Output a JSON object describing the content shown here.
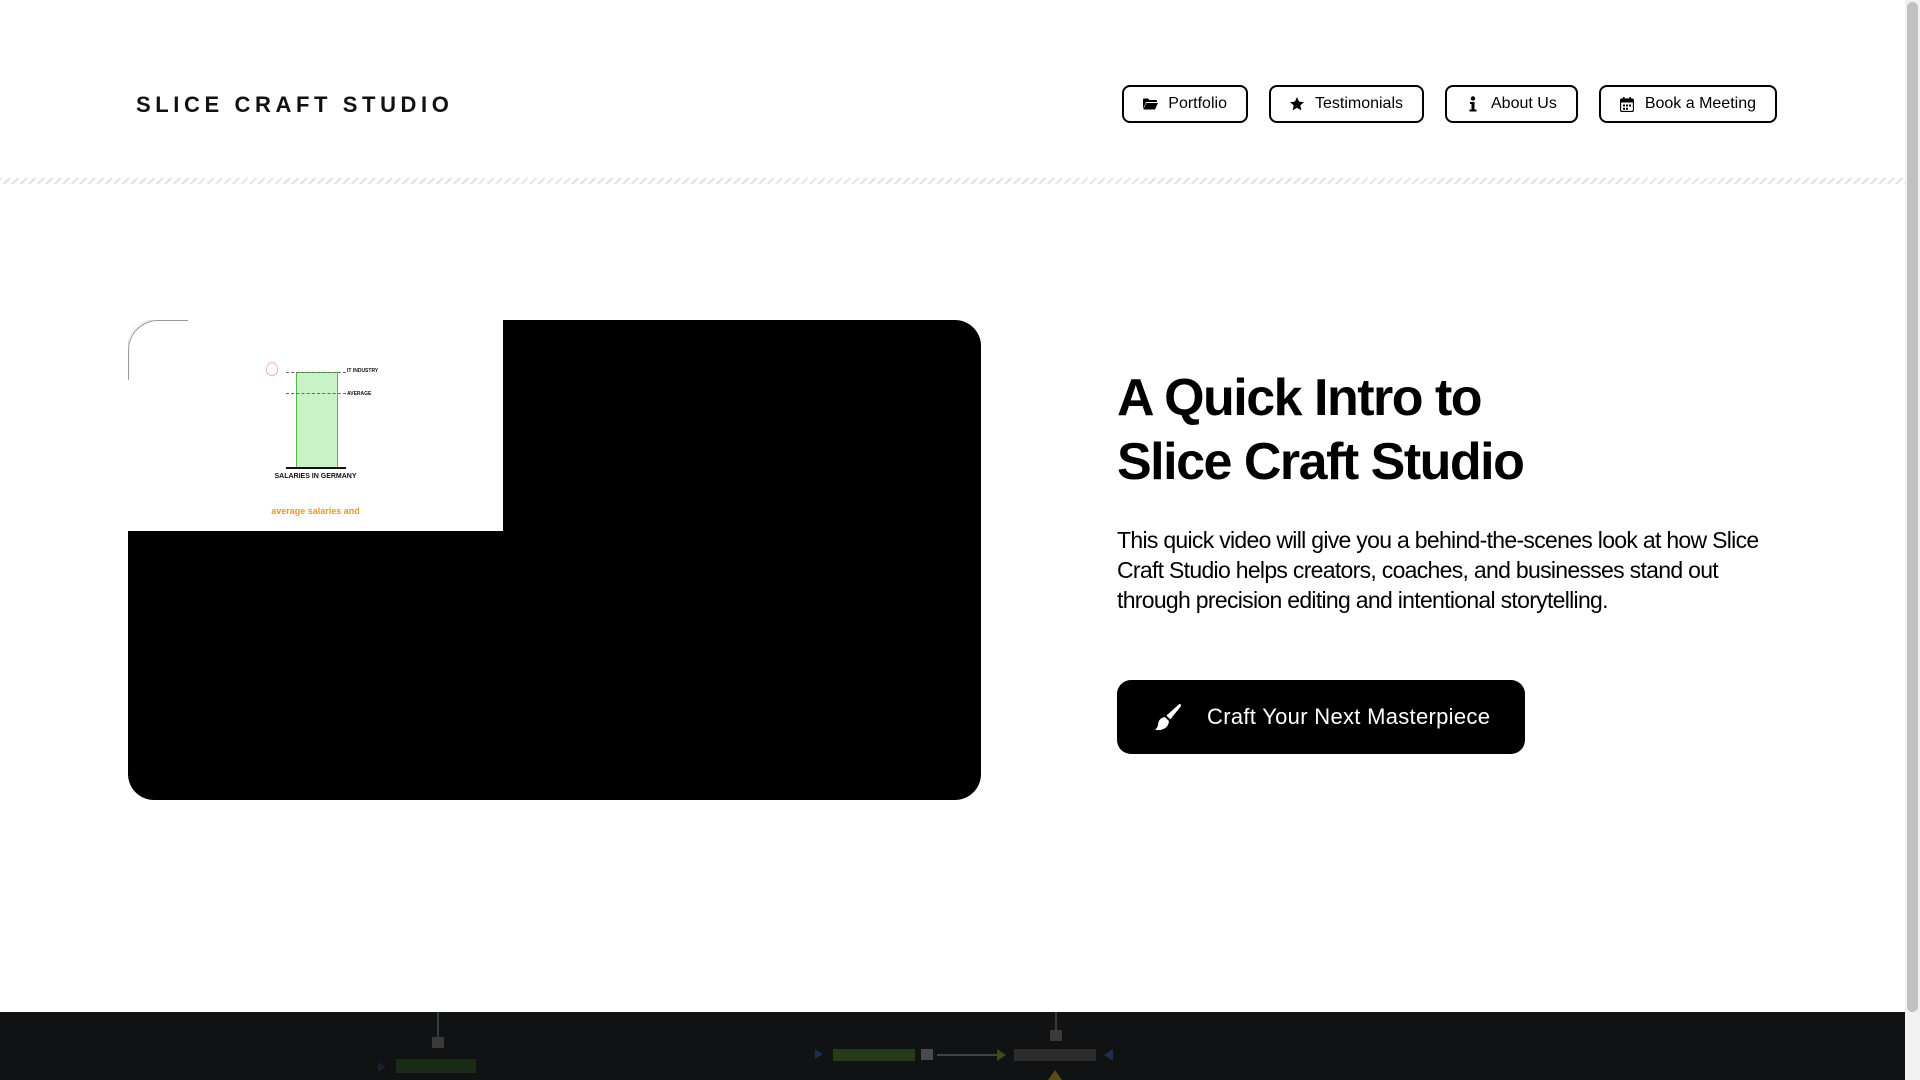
{
  "header": {
    "brand": "SLICE CRAFT STUDIO",
    "nav": [
      {
        "label": "Portfolio",
        "icon": "folder-icon"
      },
      {
        "label": "Testimonials",
        "icon": "star-icon"
      },
      {
        "label": "About Us",
        "icon": "info-icon"
      },
      {
        "label": "Book a Meeting",
        "icon": "calendar-icon"
      }
    ]
  },
  "video": {
    "thumbnail": {
      "legend_top": "IT INDUSTRY",
      "legend_mid": "AVERAGE",
      "caption": "SALARIES IN GERMANY",
      "subtitle": "average salaries and"
    }
  },
  "intro": {
    "title_line1": "A Quick Intro to",
    "title_line2": "Slice Craft Studio",
    "description": "This quick video will give you a behind-the-scenes look at how Slice Craft Studio helps creators, coaches, and businesses stand out through precision editing and intentional storytelling.",
    "cta_label": "Craft Your Next Masterpiece",
    "cta_icon": "paintbrush-icon"
  },
  "colors": {
    "accent": "#000000",
    "background": "#ffffff",
    "chart_bar": "#c9f2c6",
    "chart_subtitle": "#e39a1e",
    "bottom_band": "#111214"
  }
}
